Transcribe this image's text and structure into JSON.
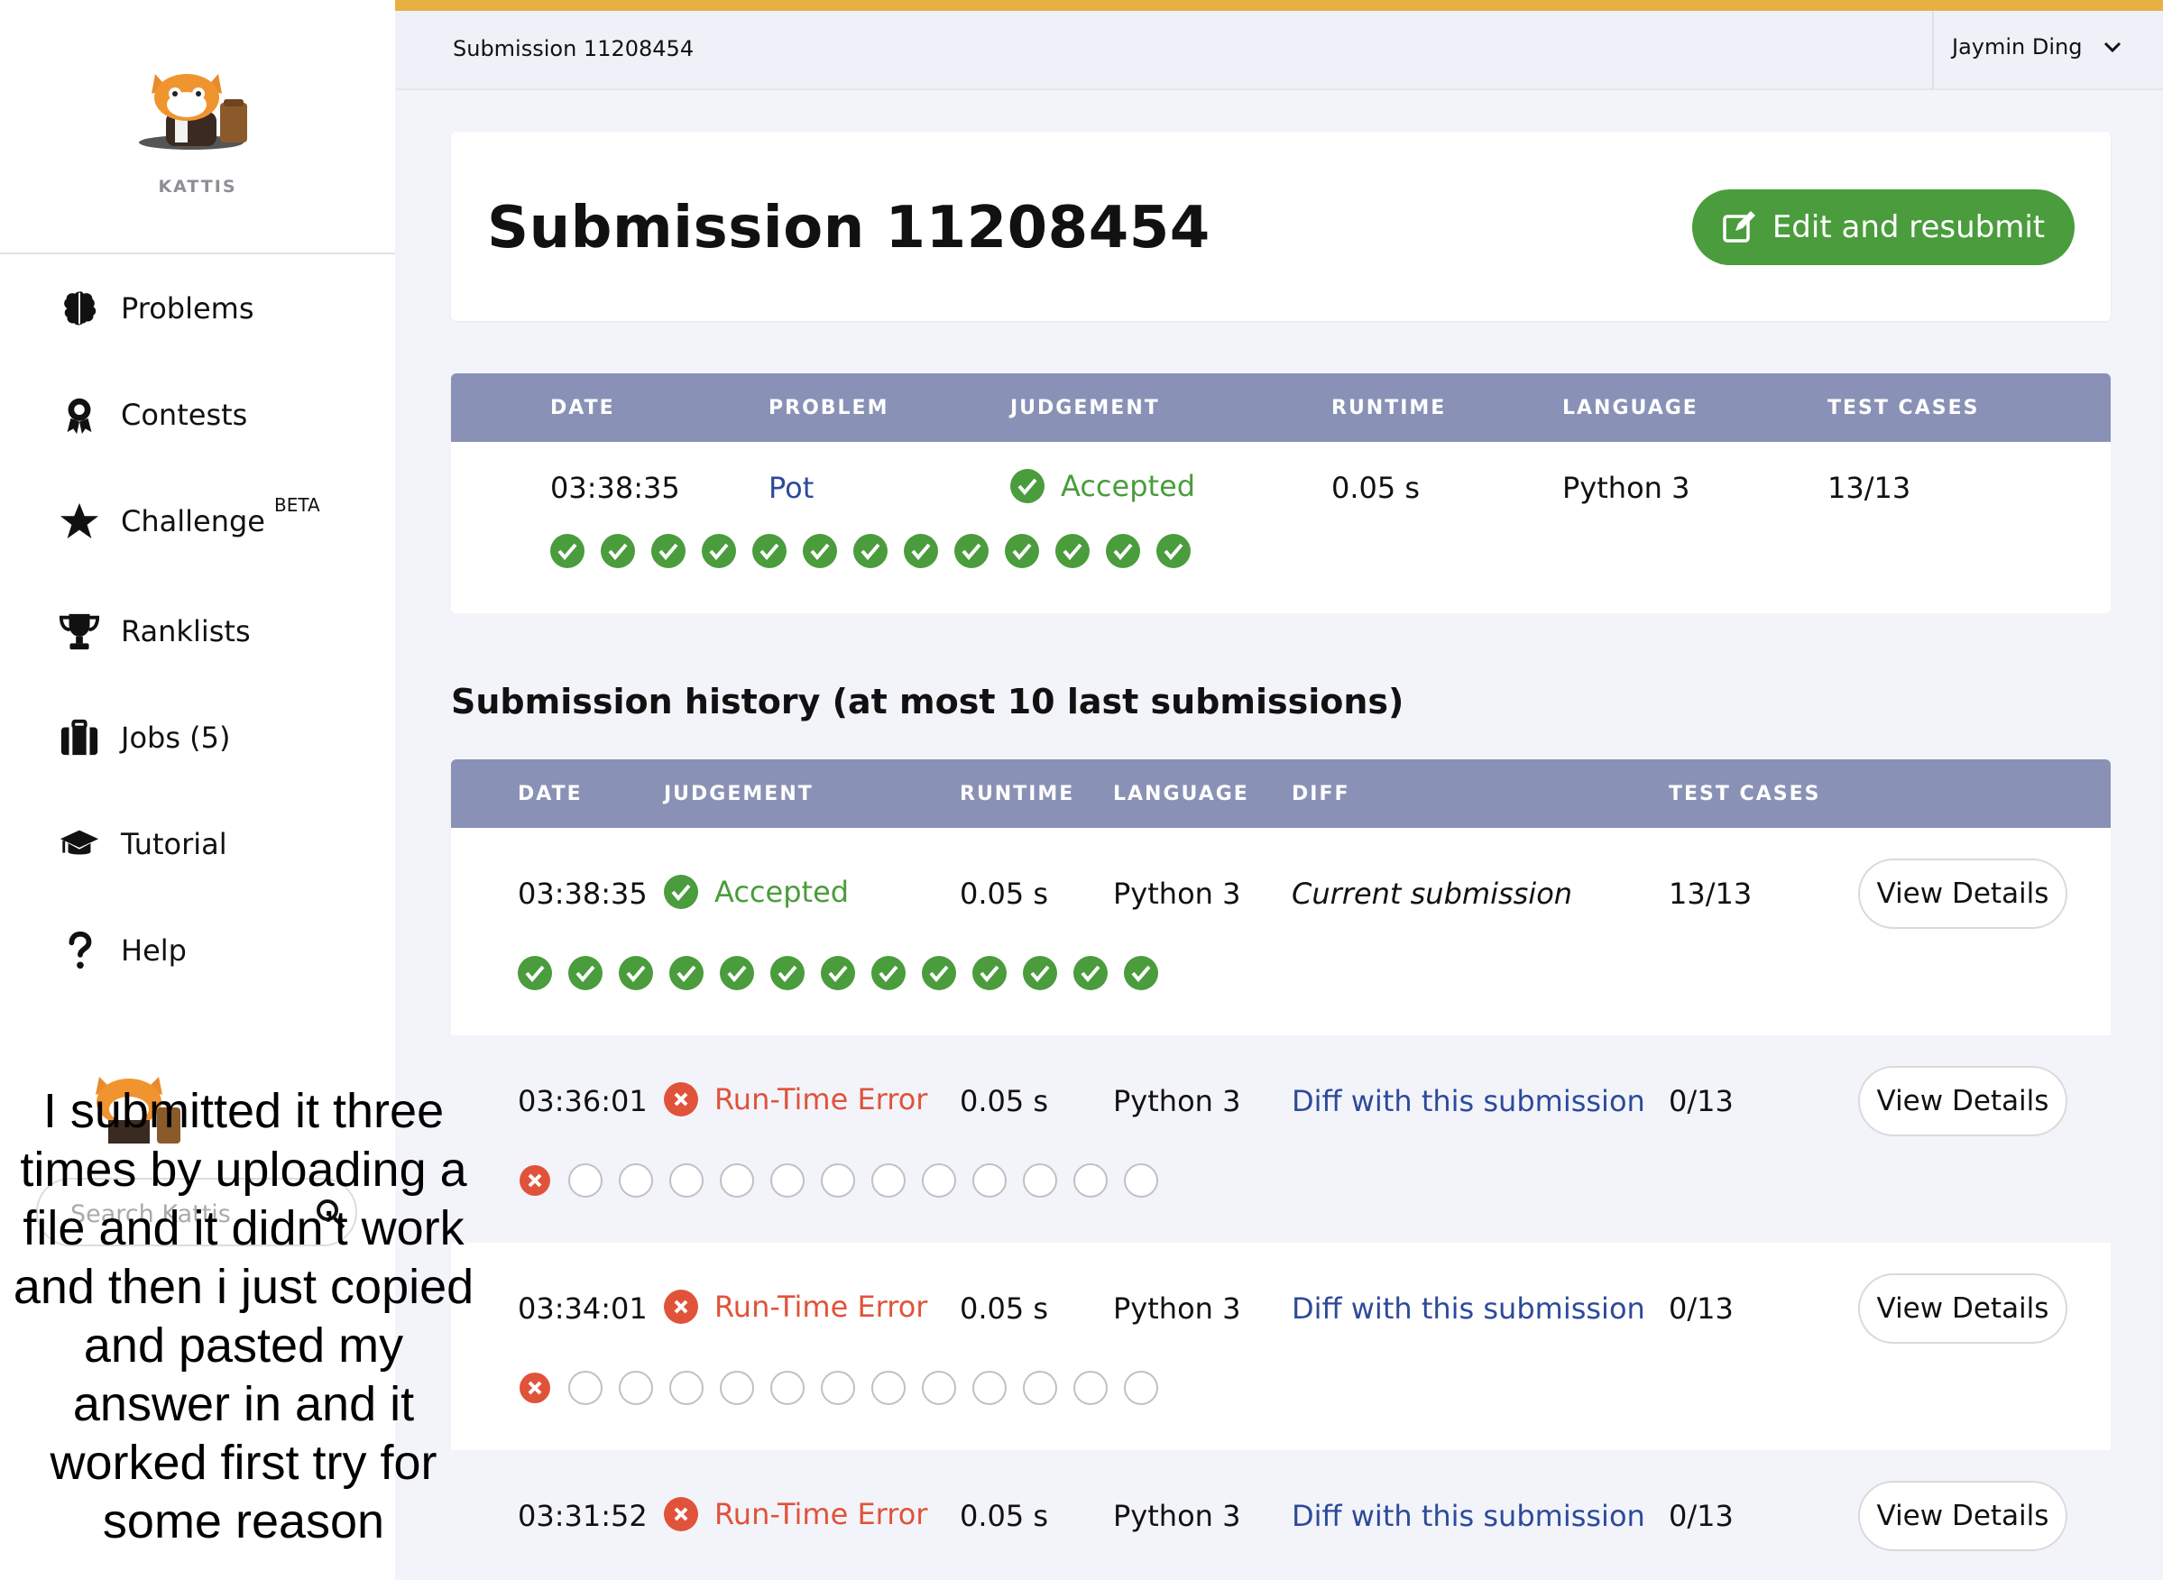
{
  "sidebar": {
    "logo_text": "KATTIS",
    "items": [
      {
        "label": "Problems",
        "icon": "brain-icon"
      },
      {
        "label": "Contests",
        "icon": "award-icon"
      },
      {
        "label": "Challenge",
        "icon": "star-icon",
        "badge": "BETA"
      },
      {
        "label": "Ranklists",
        "icon": "trophy-icon"
      },
      {
        "label": "Jobs (5)",
        "icon": "briefcase-icon"
      },
      {
        "label": "Tutorial",
        "icon": "graduation-cap-icon"
      },
      {
        "label": "Help",
        "icon": "question-icon"
      }
    ],
    "search_placeholder": "Search Kattis"
  },
  "topbar": {
    "breadcrumb": "Submission 11208454",
    "user": "Jaymin Ding"
  },
  "header": {
    "title": "Submission 11208454",
    "resubmit_label": "Edit and resubmit"
  },
  "submission": {
    "columns": [
      "DATE",
      "PROBLEM",
      "JUDGEMENT",
      "RUNTIME",
      "LANGUAGE",
      "TEST CASES"
    ],
    "date": "03:38:35",
    "problem": "Pot",
    "judgement": "Accepted",
    "runtime": "0.05 s",
    "language": "Python 3",
    "test_cases": "13/13",
    "tests_passed": 13,
    "tests_total": 13
  },
  "history": {
    "title": "Submission history (at most 10 last submissions)",
    "columns": [
      "DATE",
      "JUDGEMENT",
      "RUNTIME",
      "LANGUAGE",
      "DIFF",
      "TEST CASES"
    ],
    "view_label": "View Details",
    "rows": [
      {
        "date": "03:38:35",
        "judgement": "Accepted",
        "runtime": "0.05 s",
        "language": "Python 3",
        "diff": "Current submission",
        "test_cases": "13/13"
      },
      {
        "date": "03:36:01",
        "judgement": "Run-Time Error",
        "runtime": "0.05 s",
        "language": "Python 3",
        "diff": "Diff with this submission",
        "test_cases": "0/13"
      },
      {
        "date": "03:34:01",
        "judgement": "Run-Time Error",
        "runtime": "0.05 s",
        "language": "Python 3",
        "diff": "Diff with this submission",
        "test_cases": "0/13"
      },
      {
        "date": "03:31:52",
        "judgement": "Run-Time Error",
        "runtime": "0.05 s",
        "language": "Python 3",
        "diff": "Diff with this submission",
        "test_cases": "0/13"
      }
    ]
  },
  "caption": "I submitted it three times by uploading a file and it didn’t work and then i just copied and pasted my answer in and it worked first try for some reason",
  "colors": {
    "accent": "#e8b042",
    "table_header": "#8a91b6",
    "success": "#4a9c3c",
    "error": "#e0533a",
    "link": "#2d4a9a"
  }
}
